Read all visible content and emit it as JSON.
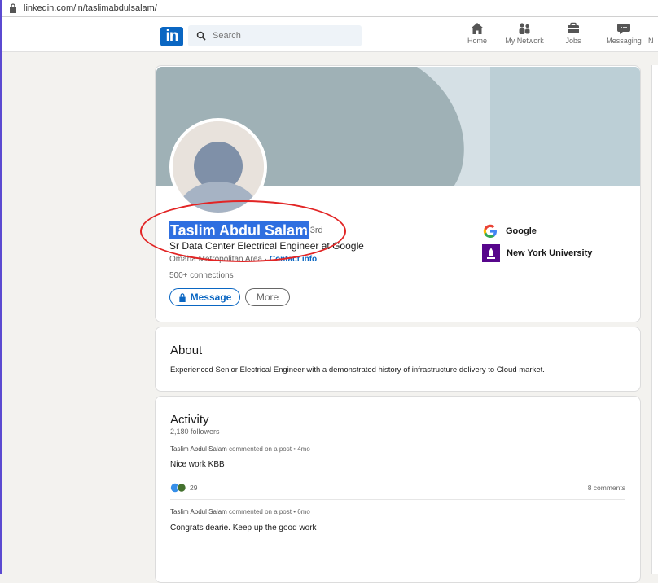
{
  "browser": {
    "url": "linkedin.com/in/taslimabdulsalam/"
  },
  "nav": {
    "logo": "in",
    "search_placeholder": "Search",
    "items": [
      {
        "label": "Home",
        "icon": "home-icon"
      },
      {
        "label": "My Network",
        "icon": "my-network-icon"
      },
      {
        "label": "Jobs",
        "icon": "jobs-icon"
      },
      {
        "label": "Messaging",
        "icon": "messaging-icon"
      },
      {
        "label": "N",
        "icon": "notifications-icon"
      }
    ]
  },
  "profile": {
    "name": "Taslim Abdul Salam",
    "degree": "· 3rd",
    "headline": "Sr Data Center Electrical Engineer at Google",
    "location": "Omaha Metropolitan Area ·",
    "contact_label": "Contact info",
    "connections": "500+ connections",
    "message_label": "Message",
    "more_label": "More",
    "companies": [
      {
        "name": "Google",
        "icon": "google-logo-icon"
      },
      {
        "name": "New York University",
        "icon": "nyu-logo-icon"
      }
    ]
  },
  "about": {
    "title": "About",
    "text": "Experienced Senior Electrical Engineer with a demonstrated history of infrastructure delivery to Cloud market."
  },
  "activity": {
    "title": "Activity",
    "followers": "2,180 followers",
    "posts": [
      {
        "meta_name": "Taslim Abdul Salam",
        "meta_action": "commented on a post • 4mo",
        "text": "Nice work KBB",
        "reactions": "29",
        "comments": "8 comments"
      },
      {
        "meta_name": "Taslim Abdul Salam",
        "meta_action": "commented on a post • 6mo",
        "text": "Congrats dearie. Keep up the good work"
      }
    ]
  },
  "colors": {
    "linkedin_blue": "#0a66c2",
    "highlight": "#2f6fe0",
    "annotation_red": "#e22525"
  }
}
